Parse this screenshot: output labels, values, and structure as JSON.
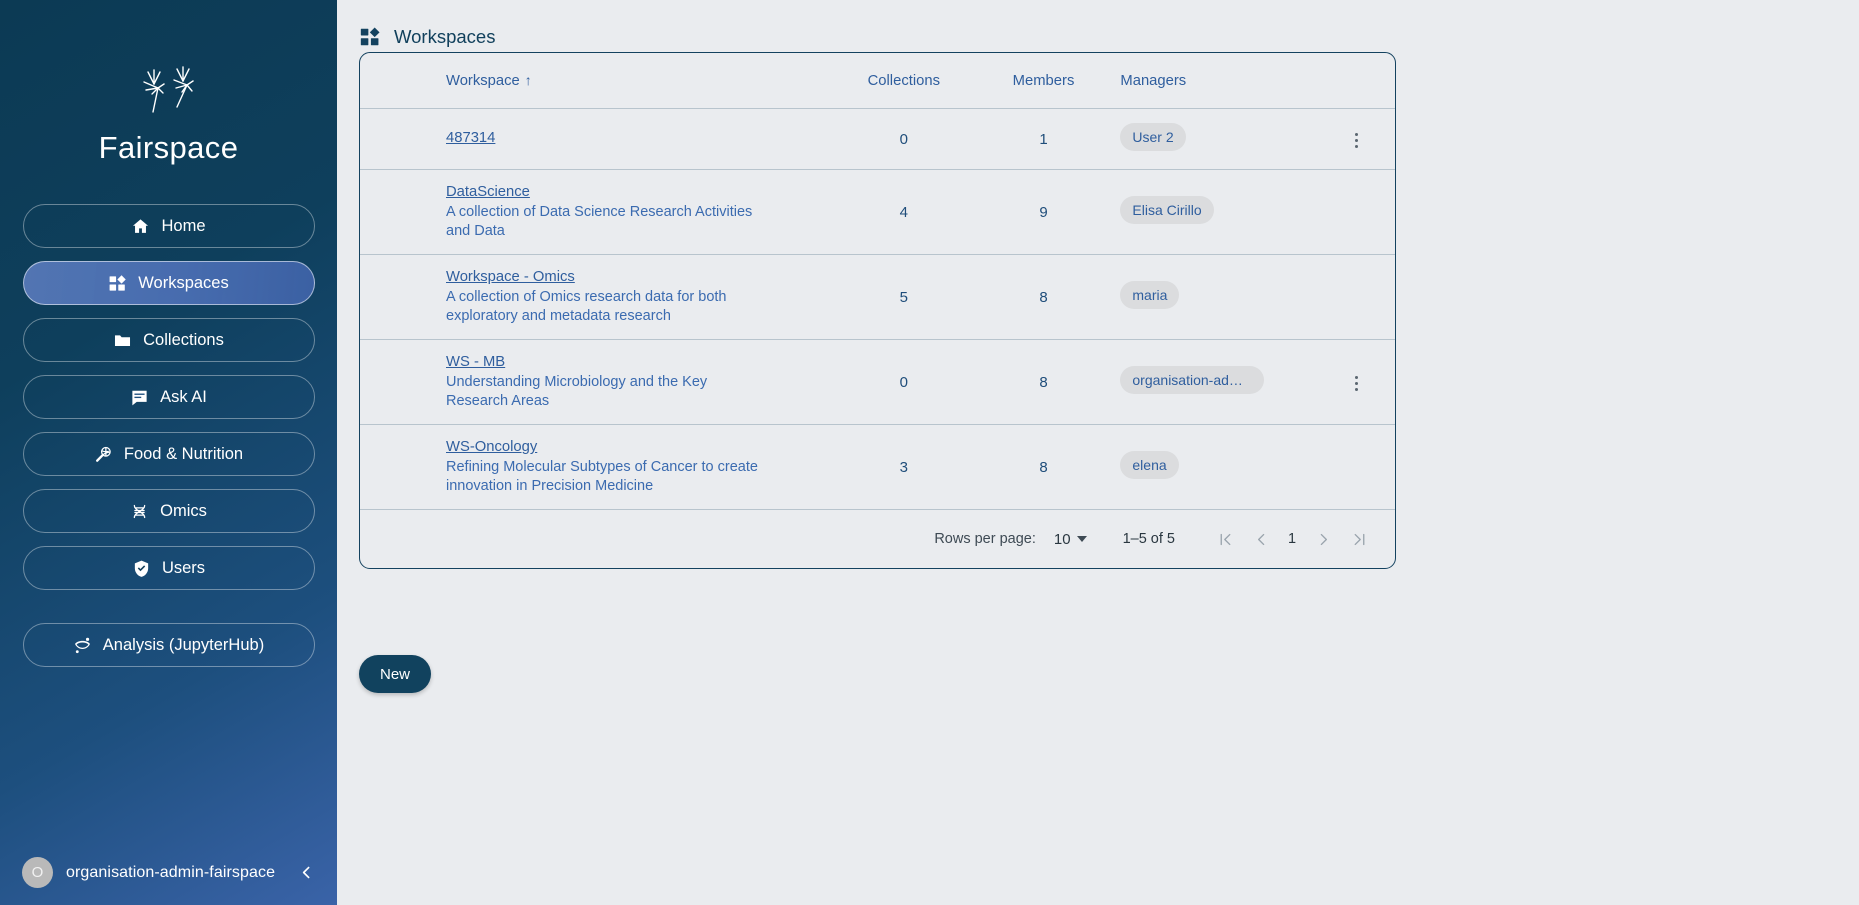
{
  "sidebar": {
    "brand": {
      "name": "Fairspace",
      "logo_icon": "dandelion-logo-icon"
    },
    "items": [
      {
        "label": "Home",
        "icon": "home-icon",
        "active": false
      },
      {
        "label": "Workspaces",
        "icon": "dashboard-icon",
        "active": true
      },
      {
        "label": "Collections",
        "icon": "folder-icon",
        "active": false
      },
      {
        "label": "Ask AI",
        "icon": "chat-icon",
        "active": false
      },
      {
        "label": "Food & Nutrition",
        "icon": "magnifier-icon",
        "active": false
      },
      {
        "label": "Omics",
        "icon": "dna-icon",
        "active": false
      },
      {
        "label": "Users",
        "icon": "shield-check-icon",
        "active": false
      }
    ],
    "secondary_items": [
      {
        "label": "Analysis (JupyterHub)",
        "icon": "jupyter-icon",
        "active": false
      }
    ],
    "footer": {
      "avatar_initial": "O",
      "username": "organisation-admin-fairspace",
      "collapse_icon": "chevron-left-icon"
    }
  },
  "header": {
    "title": "Workspaces",
    "icon": "dashboard-icon"
  },
  "table": {
    "columns": {
      "workspace": "Workspace",
      "collections": "Collections",
      "members": "Members",
      "managers": "Managers"
    },
    "sort": {
      "column": "Workspace",
      "direction": "asc",
      "glyph": "↑"
    },
    "rows": [
      {
        "name": "487314",
        "description": "",
        "collections": "0",
        "members": "1",
        "manager": "User 2",
        "has_menu": true
      },
      {
        "name": "DataScience",
        "description": "A collection of Data Science Research Activities and Data",
        "collections": "4",
        "members": "9",
        "manager": "Elisa Cirillo",
        "has_menu": false
      },
      {
        "name": "Workspace - Omics",
        "description": "A collection of Omics research data for both exploratory and metadata research",
        "collections": "5",
        "members": "8",
        "manager": "maria",
        "has_menu": false
      },
      {
        "name": "WS - MB",
        "description": "Understanding Microbiology and the Key Research Areas",
        "collections": "0",
        "members": "8",
        "manager": "organisation-admin…",
        "has_menu": true
      },
      {
        "name": "WS-Oncology",
        "description": "Refining Molecular Subtypes of Cancer to create innovation in Precision Medicine",
        "collections": "3",
        "members": "8",
        "manager": "elena",
        "has_menu": false
      }
    ]
  },
  "pagination": {
    "rows_per_page_label": "Rows per page:",
    "rows_per_page_value": "10",
    "range": "1–5 of 5",
    "current_page": "1",
    "first_icon": "first-page-icon",
    "prev_icon": "previous-page-icon",
    "next_icon": "next-page-icon",
    "last_icon": "last-page-icon"
  },
  "actions": {
    "new_label": "New"
  },
  "colors": {
    "sidebar_dark": "#0c3a54",
    "sidebar_light": "#3a63a8",
    "accent_dark": "#11425e",
    "link": "#2f5e9e",
    "page_bg": "#eaecef",
    "chip_bg": "#dbdcde"
  }
}
